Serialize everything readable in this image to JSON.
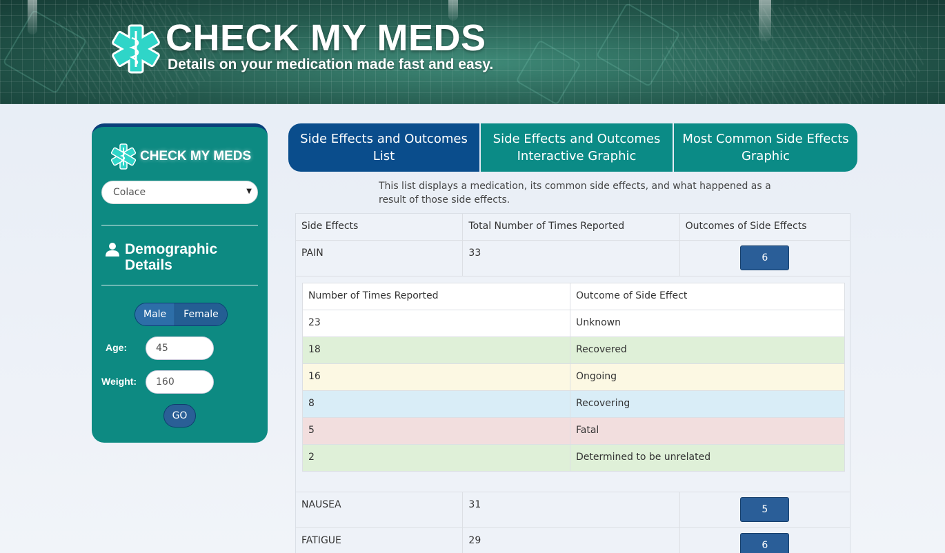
{
  "header": {
    "title": "CHECK MY MEDS",
    "tagline": "Details on your medication made fast and easy."
  },
  "sidebar": {
    "brand": "CHECK MY MEDS",
    "medication_select": {
      "value": "Colace"
    },
    "demographic_title": "Demographic Details",
    "gender": {
      "male": "Male",
      "female": "Female"
    },
    "age": {
      "label": "Age:",
      "value": "45"
    },
    "weight": {
      "label": "Weight:",
      "value": "160"
    },
    "go_label": "GO"
  },
  "tabs": [
    {
      "label": "Side Effects and Outcomes List",
      "active": true
    },
    {
      "label": "Side Effects and Outcomes Interactive Graphic",
      "active": false
    },
    {
      "label": "Most Common Side Effects Graphic",
      "active": false
    }
  ],
  "intro": "This list displays a medication, its common side effects, and what happened as a result of those side effects.",
  "table": {
    "headers": [
      "Side Effects",
      "Total Number of Times Reported",
      "Outcomes of Side Effects"
    ],
    "rows": [
      {
        "effect": "PAIN",
        "total": "33",
        "outcomes": "6"
      },
      {
        "effect": "NAUSEA",
        "total": "31",
        "outcomes": "5"
      },
      {
        "effect": "FATIGUE",
        "total": "29",
        "outcomes": "6"
      }
    ]
  },
  "subtable": {
    "headers": [
      "Number of Times Reported",
      "Outcome of Side Effect"
    ],
    "rows": [
      {
        "count": "23",
        "outcome": "Unknown",
        "color": "#ffffff"
      },
      {
        "count": "18",
        "outcome": "Recovered",
        "color": "#dff0d8"
      },
      {
        "count": "16",
        "outcome": "Ongoing",
        "color": "#fcf8e3"
      },
      {
        "count": "8",
        "outcome": "Recovering",
        "color": "#d9edf7"
      },
      {
        "count": "5",
        "outcome": "Fatal",
        "color": "#f2dede"
      },
      {
        "count": "2",
        "outcome": "Determined to be unrelated",
        "color": "#dff0d8"
      }
    ]
  },
  "colors": {
    "teal": "#0d8a82",
    "navy": "#0a4d8c",
    "button_blue": "#2a5e98"
  }
}
